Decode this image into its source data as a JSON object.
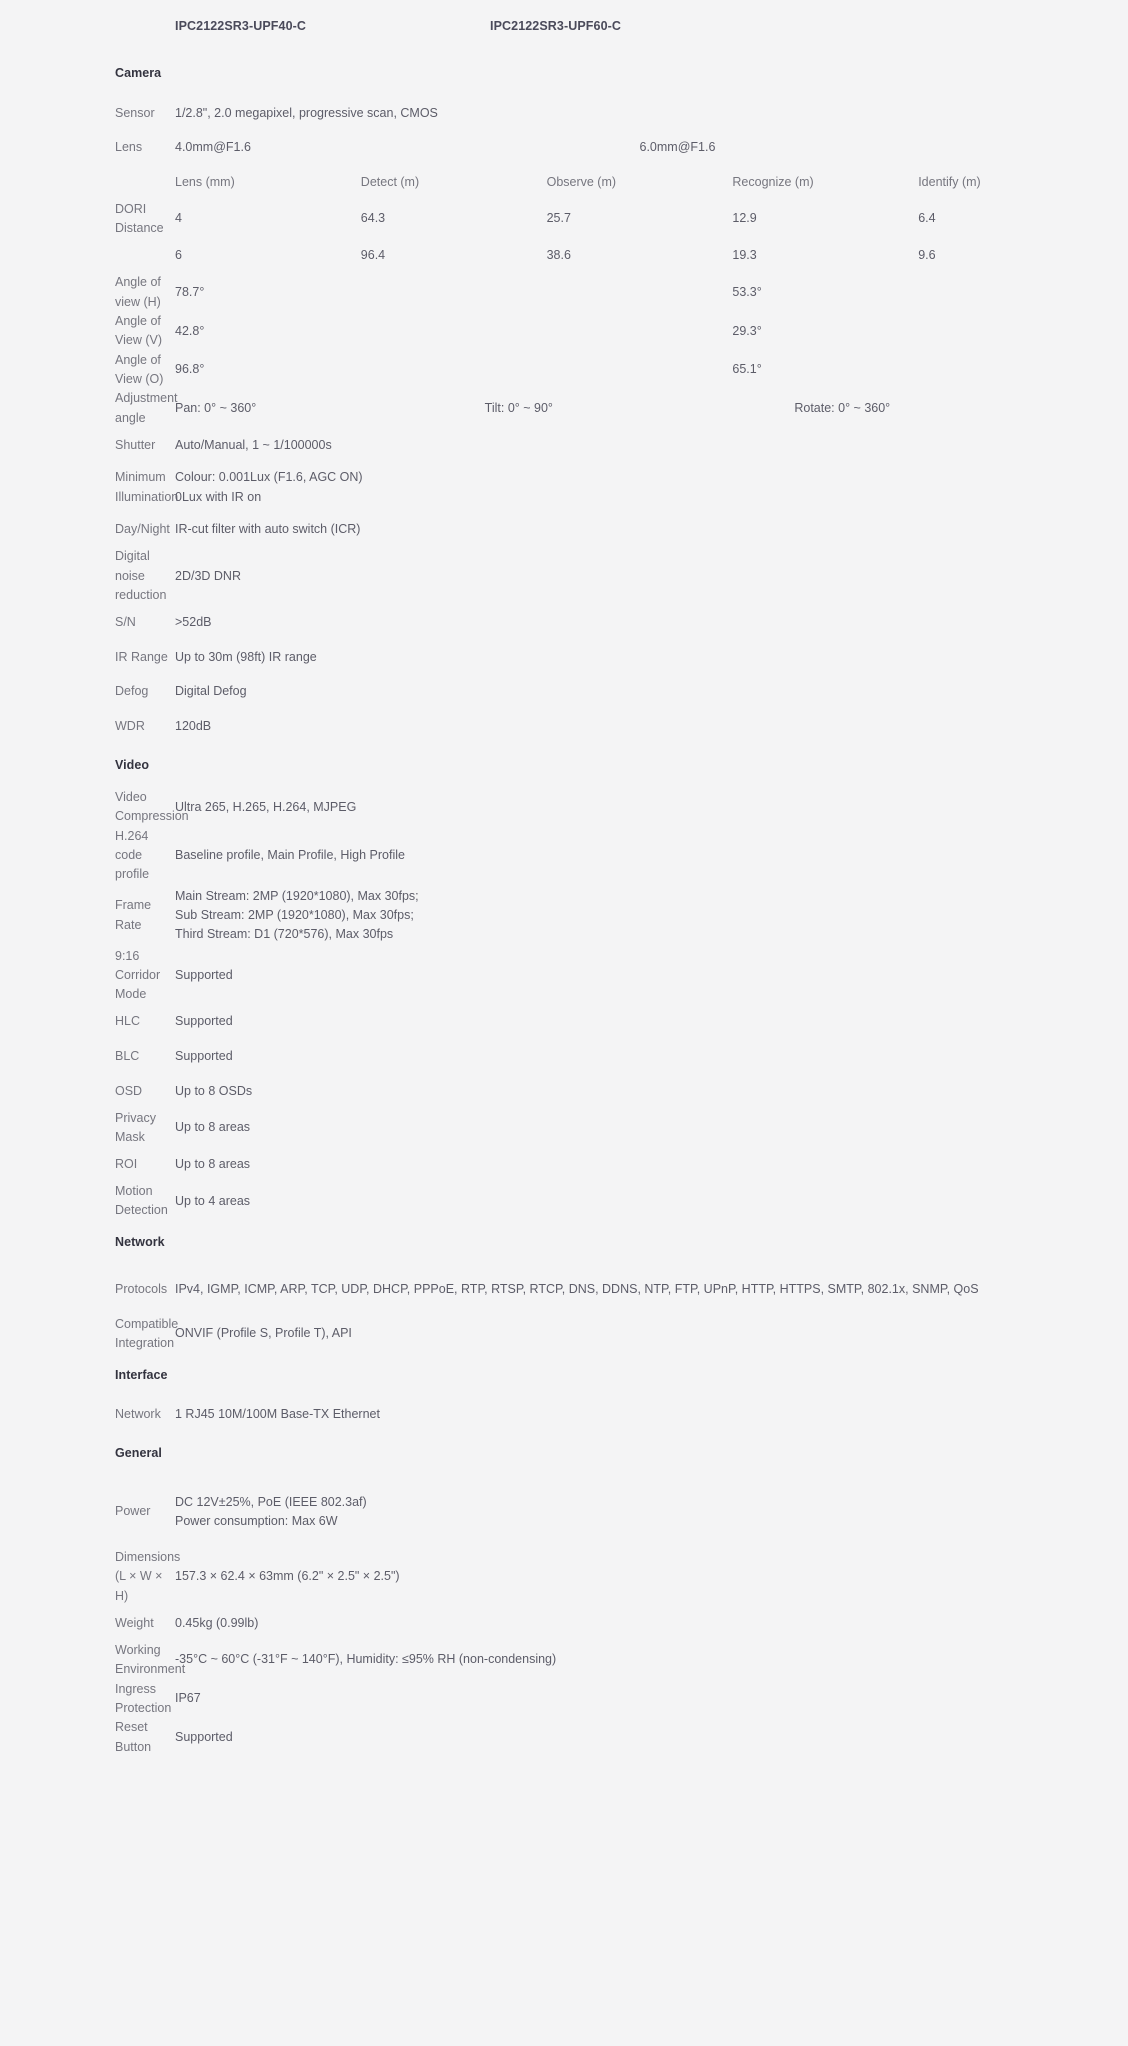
{
  "header": {
    "model_a": "IPC2122SR3-UPF40-C",
    "model_b": "IPC2122SR3-UPF60-C"
  },
  "sections": {
    "camera": "Camera",
    "video": "Video",
    "network": "Network",
    "interface": "Interface",
    "general": "General"
  },
  "camera": {
    "sensor_label": "Sensor",
    "sensor_value": "1/2.8\", 2.0 megapixel, progressive scan, CMOS",
    "lens_label": "Lens",
    "lens_a": "4.0mm@F1.6",
    "lens_b": "6.0mm@F1.6",
    "dori_head": {
      "c0": "",
      "c1": "Lens (mm)",
      "c2": "Detect (m)",
      "c3": "Observe (m)",
      "c4": "Recognize (m)",
      "c5": "Identify (m)"
    },
    "dori_label": "DORI Distance",
    "dori_rows": [
      {
        "lens": "4",
        "detect": "64.3",
        "observe": "25.7",
        "recognize": "12.9",
        "identify": "6.4"
      },
      {
        "lens": "6",
        "detect": "96.4",
        "observe": "38.6",
        "recognize": "19.3",
        "identify": "9.6"
      }
    ],
    "aov_h_label": "Angle of view (H)",
    "aov_h_a": "78.7°",
    "aov_h_b": "53.3°",
    "aov_v_label": "Angle of View (V)",
    "aov_v_a": "42.8°",
    "aov_v_b": "29.3°",
    "aov_o_label": "Angle of View (O)",
    "aov_o_a": "96.8°",
    "aov_o_b": "65.1°",
    "adjust_label": "Adjustment angle",
    "adjust_pan": "Pan: 0° ~ 360°",
    "adjust_tilt": "Tilt: 0° ~ 90°",
    "adjust_rotate": "Rotate: 0° ~ 360°",
    "shutter_label": "Shutter",
    "shutter_value": "Auto/Manual, 1 ~ 1/100000s",
    "min_illum_label": "Minimum Illumination",
    "min_illum_value": "Colour: 0.001Lux (F1.6, AGC ON)\n0Lux with IR on",
    "day_night_label": "Day/Night",
    "day_night_value": "IR-cut filter with auto switch (ICR)",
    "dnr_label": "Digital noise reduction",
    "dnr_value": "2D/3D DNR",
    "sn_label": "S/N",
    "sn_value": ">52dB",
    "ir_label": "IR Range",
    "ir_value": "Up to 30m (98ft) IR range",
    "defog_label": "Defog",
    "defog_value": "Digital Defog",
    "wdr_label": "WDR",
    "wdr_value": "120dB"
  },
  "video": {
    "compression_label": "Video Compression",
    "compression_value": "Ultra 265, H.265, H.264, MJPEG",
    "h264_label": "H.264 code profile",
    "h264_value": "Baseline profile, Main Profile, High Profile",
    "framerate_label": "Frame Rate",
    "framerate_value": "Main Stream: 2MP (1920*1080), Max 30fps;\nSub Stream: 2MP (1920*1080), Max 30fps;\nThird Stream: D1 (720*576), Max 30fps",
    "corridor_label": "9:16 Corridor Mode",
    "corridor_value": "Supported",
    "hlc_label": "HLC",
    "hlc_value": "Supported",
    "blc_label": "BLC",
    "blc_value": "Supported",
    "osd_label": "OSD",
    "osd_value": "Up to 8 OSDs",
    "privacy_label": "Privacy Mask",
    "privacy_value": "Up to 8 areas",
    "roi_label": "ROI",
    "roi_value": "Up to 8 areas",
    "motion_label": "Motion Detection",
    "motion_value": "Up to 4 areas"
  },
  "network": {
    "protocols_label": "Protocols",
    "protocols_value": "IPv4, IGMP, ICMP, ARP, TCP, UDP, DHCP, PPPoE, RTP, RTSP, RTCP, DNS, DDNS, NTP, FTP, UPnP, HTTP, HTTPS, SMTP, 802.1x, SNMP, QoS",
    "integration_label": "Compatible Integration",
    "integration_value": "ONVIF (Profile S, Profile T), API"
  },
  "interface": {
    "network_label": "Network",
    "network_value": "1 RJ45 10M/100M Base-TX Ethernet"
  },
  "general": {
    "power_label": "Power",
    "power_line1": "DC 12V±25%, PoE (IEEE 802.3af)",
    "power_line2": "Power consumption: Max 6W",
    "dimensions_label": "Dimensions (L × W × H)",
    "dimensions_value": "157.3 × 62.4 × 63mm (6.2\" × 2.5\" × 2.5\")",
    "weight_label": "Weight",
    "weight_value": "0.45kg (0.99lb)",
    "environment_label": "Working Environment",
    "environment_value": "-35°C ~ 60°C (-31°F ~ 140°F), Humidity: ≤95% RH (non-condensing)",
    "ingress_label": "Ingress Protection",
    "ingress_value": "IP67",
    "reset_label": "Reset Button",
    "reset_value": "Supported"
  },
  "colors": {
    "background": "#f4f4f5",
    "label_text": "#76767f",
    "value_text": "#5c5c68",
    "heading_text": "#33333f"
  }
}
